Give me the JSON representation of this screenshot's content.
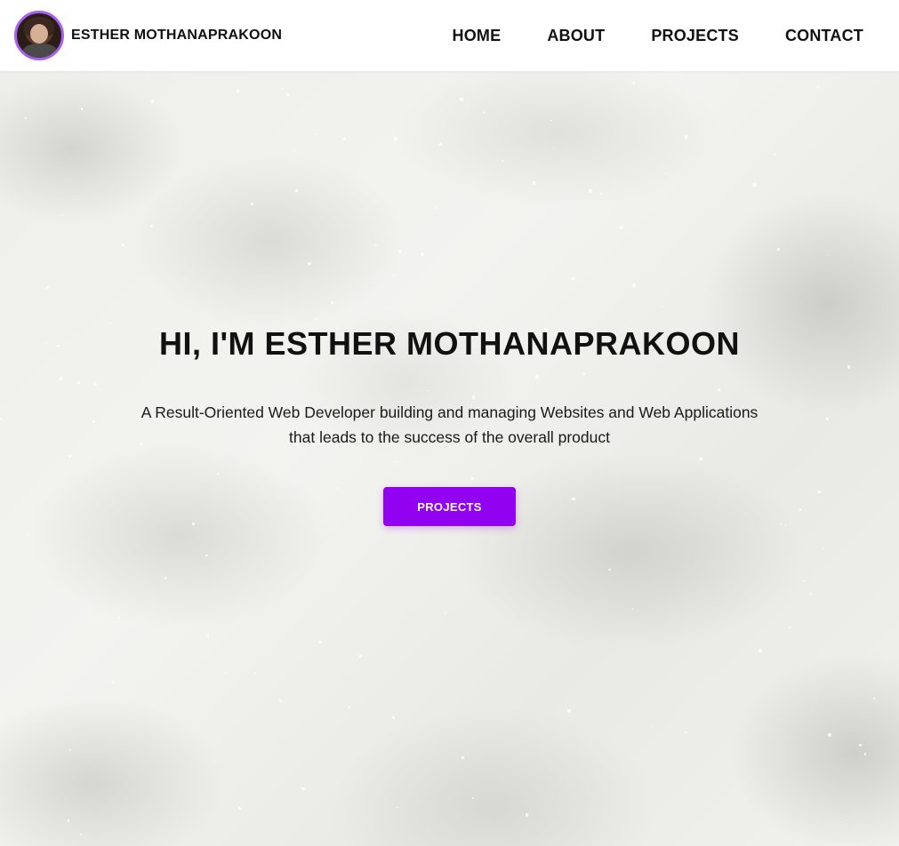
{
  "header": {
    "brand_name": "ESTHER MOTHANAPRAKOON",
    "avatar_alt": "Profile photo",
    "nav": [
      {
        "label": "HOME"
      },
      {
        "label": "ABOUT"
      },
      {
        "label": "PROJECTS"
      },
      {
        "label": "CONTACT"
      }
    ]
  },
  "hero": {
    "title": "HI, I'M ESTHER MOTHANAPRAKOON",
    "subtitle_line1": "A Result-Oriented Web Developer building and managing Websites and Web Applications",
    "subtitle_line2": "that leads to the success of the overall product",
    "cta_label": "PROJECTS"
  },
  "colors": {
    "accent": "#9102f0",
    "avatar_border": "#a760f0",
    "header_bg": "#ffffff",
    "text": "#111111"
  }
}
